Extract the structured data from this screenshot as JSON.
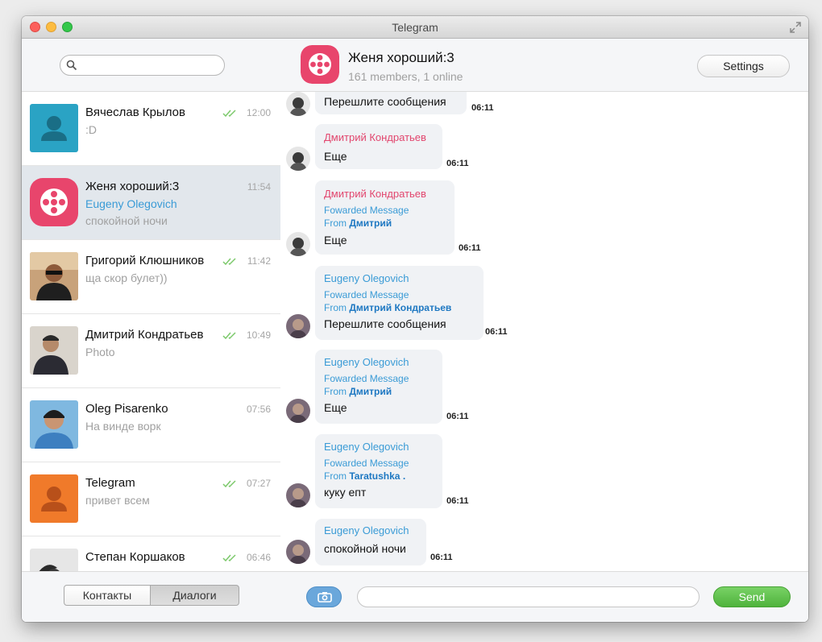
{
  "window": {
    "title": "Telegram"
  },
  "colors": {
    "accent_blue": "#3a9bd6",
    "name_pink": "#e2466e",
    "send_green": "#58bb44",
    "active_row": "#e2e7ec"
  },
  "sidebar": {
    "search": {
      "value": "",
      "placeholder": ""
    },
    "dialogs": [
      {
        "name": "Вячеслав Крылов",
        "sender": "",
        "preview": ":D",
        "time": "12:00",
        "read": true,
        "avatar": "person-placeholder-teal"
      },
      {
        "name": "Женя хороший:3",
        "sender": "Eugeny Olegovich",
        "preview": "спокойной ночи",
        "time": "11:54",
        "read": false,
        "avatar": "group-logo-pink",
        "active": true
      },
      {
        "name": "Григорий Клюшников",
        "sender": "",
        "preview": "ща скор булет))",
        "time": "11:42",
        "read": true,
        "avatar": "photo"
      },
      {
        "name": "Дмитрий Кондратьев",
        "sender": "",
        "preview": "Photo",
        "time": "10:49",
        "read": true,
        "avatar": "photo"
      },
      {
        "name": "Oleg Pisarenko",
        "sender": "",
        "preview": "На винде ворк",
        "time": "07:56",
        "read": false,
        "avatar": "photo"
      },
      {
        "name": "Telegram",
        "sender": "",
        "preview": "привет всем",
        "time": "07:27",
        "read": true,
        "avatar": "person-placeholder-orange"
      },
      {
        "name": "Степан Коршаков",
        "sender": "",
        "preview": "",
        "time": "06:46",
        "read": true,
        "avatar": "photo"
      }
    ],
    "tabs": {
      "contacts": "Контакты",
      "dialogs": "Диалоги"
    }
  },
  "chat": {
    "title": "Женя хороший:3",
    "subtitle": "161 members, 1 online",
    "settings_label": "Settings",
    "messages": [
      {
        "sender": "",
        "fwd_label": "",
        "from_label": "",
        "from_name": "",
        "text": "Перешлите сообщения",
        "time": "06:11"
      },
      {
        "sender": "Дмитрий Кондратьев",
        "fwd_label": "",
        "from_label": "",
        "from_name": "",
        "text": "Еще",
        "time": "06:11"
      },
      {
        "sender": "Дмитрий Кондратьев",
        "fwd_label": "Fowarded Message",
        "from_label": "From",
        "from_name": "Дмитрий",
        "text": "Еще",
        "time": "06:11"
      },
      {
        "sender": "Eugeny Olegovich",
        "fwd_label": "Fowarded Message",
        "from_label": "From",
        "from_name": "Дмитрий Кондратьев",
        "text": "Перешлите сообщения",
        "time": "06:11"
      },
      {
        "sender": "Eugeny Olegovich",
        "fwd_label": "Fowarded Message",
        "from_label": "From",
        "from_name": "Дмитрий",
        "text": "Еще",
        "time": "06:11"
      },
      {
        "sender": "Eugeny Olegovich",
        "fwd_label": "Fowarded Message",
        "from_label": "From",
        "from_name": "Taratushka .",
        "text": "куку епт",
        "time": "06:11"
      },
      {
        "sender": "Eugeny Olegovich",
        "fwd_label": "",
        "from_label": "",
        "from_name": "",
        "text": "спокойной ночи",
        "time": "06:11"
      }
    ],
    "composer": {
      "value": "",
      "placeholder": "",
      "send_label": "Send"
    }
  }
}
